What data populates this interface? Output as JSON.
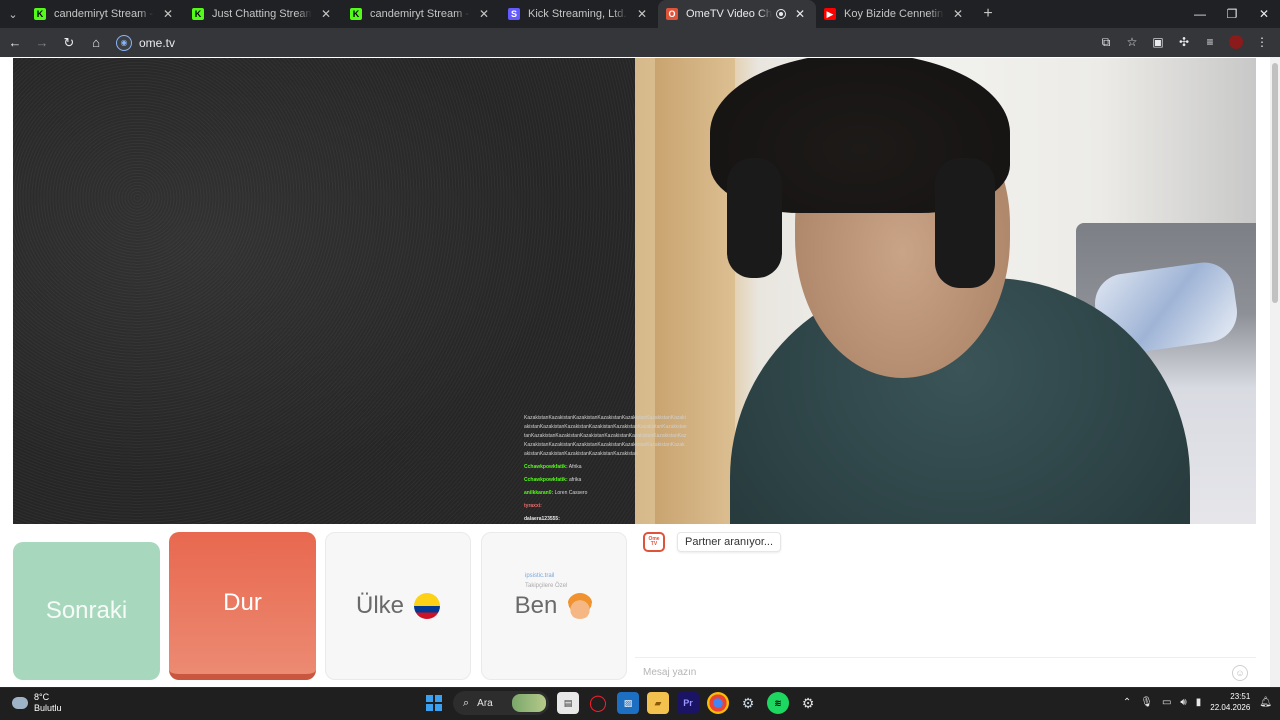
{
  "browser": {
    "tabs": [
      {
        "title": "candemiryt Stream - Watch Live",
        "favicon": "kick-icon",
        "color": "#53fc18",
        "active": false
      },
      {
        "title": "Just Chatting Streaming - Live S",
        "favicon": "kick-icon",
        "color": "#53fc18",
        "active": false
      },
      {
        "title": "candemiryt Stream - Watch Live",
        "favicon": "kick-icon",
        "color": "#53fc18",
        "active": false
      },
      {
        "title": "Kick Streaming, Ltd. | Set up pay",
        "favicon": "stripe-icon",
        "color": "#635bff",
        "active": false
      },
      {
        "title": "OmeTV Video Chat — Ome",
        "favicon": "ometv-icon",
        "color": "#e0533b",
        "active": true
      },
      {
        "title": "Koy Bizide Cennetine | Abdurra",
        "favicon": "youtube-icon",
        "color": "#ff0000",
        "active": false
      }
    ],
    "url": "ome.tv"
  },
  "stream_overlay": {
    "spam_lines": [
      "KazakistanKazakistanKazakistanKazakistanKazakistanKazakistanKazaki",
      "akistanKazakistanKazakistanKazakistanKazakistanKazakistanKazakistan",
      "tanKazakistanKazakistanKazakistanKazakistanKazakistanKazakistanKaz",
      "KazakistanKazakistanKazakistanKazakistanKazakistanKazakistanKazak",
      "akistanKazakistanKazakistanKazakistanKazakistan"
    ],
    "messages": [
      {
        "user": "Cchawkpowkfatik:",
        "text": "Afrika"
      },
      {
        "user": "Cchawkpowkfatik:",
        "text": "afrika"
      },
      {
        "user": "anilkkaran0:",
        "text": "Loren Cassero"
      },
      {
        "user": "tyraxxi:",
        "text": ""
      },
      {
        "user": "dalaera123555:",
        "text": ""
      }
    ],
    "footer_lines": [
      "ipsistic.trail",
      "Takipçilere Özel"
    ]
  },
  "controls": {
    "next_label": "Sonraki",
    "stop_label": "Dur",
    "country_label": "Ülke",
    "me_label": "Ben"
  },
  "chat": {
    "logo_text": "Ome TV",
    "status": "Partner aranıyor...",
    "input_placeholder": "Mesaj yazın"
  },
  "taskbar": {
    "weather_temp": "8°C",
    "weather_desc": "Bulutlu",
    "search_label": "Ara",
    "time": "23:51",
    "date": "22.04.2026"
  }
}
